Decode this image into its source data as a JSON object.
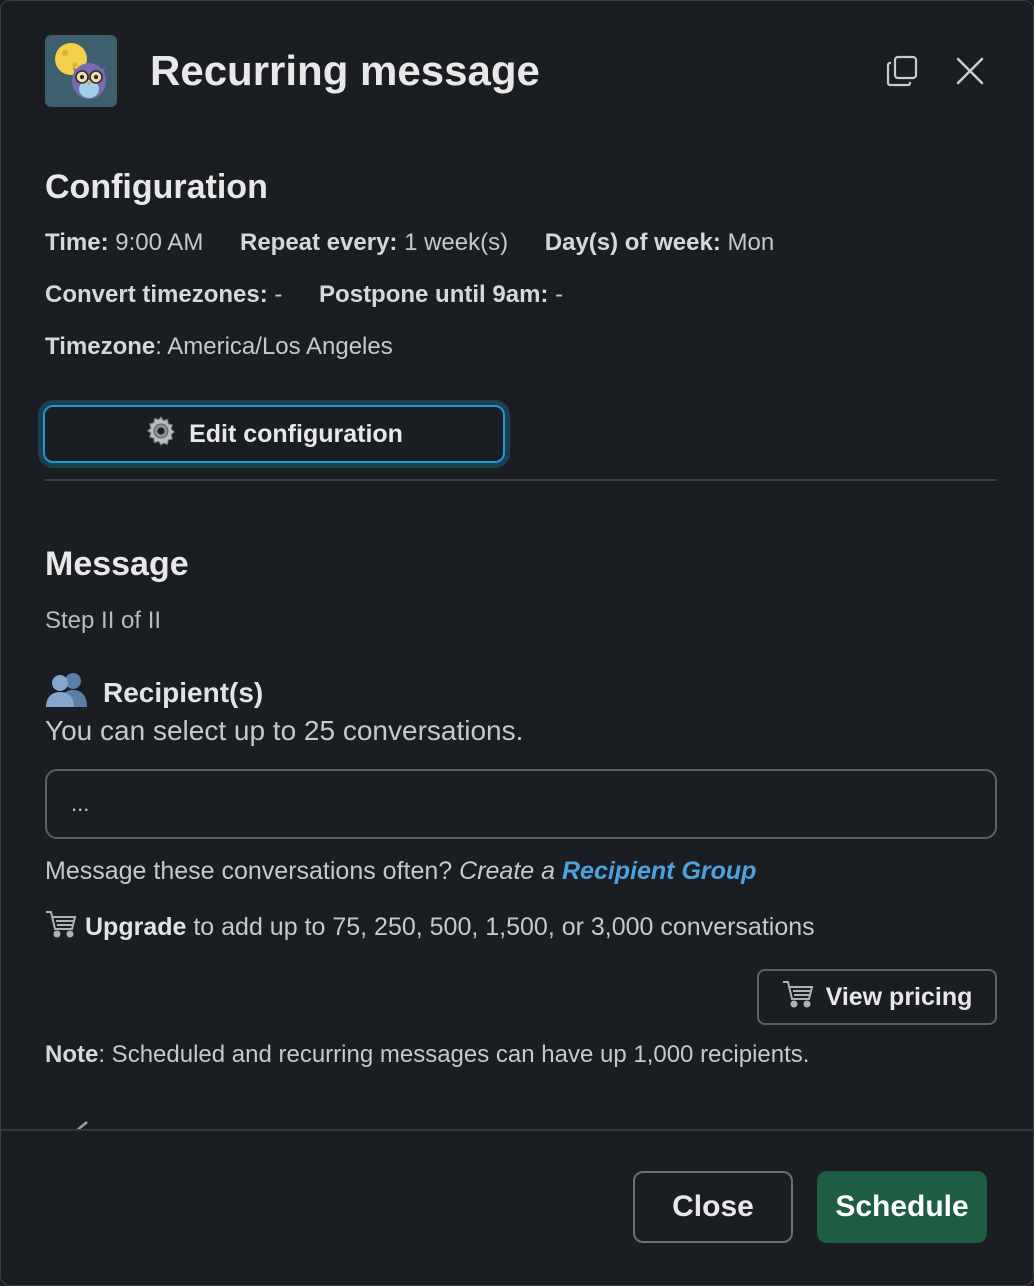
{
  "header": {
    "title": "Recurring message",
    "app_icon": "owl-moon-icon",
    "actions": [
      "copy-icon",
      "close-icon"
    ]
  },
  "configuration": {
    "heading": "Configuration",
    "time_label": "Time:",
    "time_value": "9:00 AM",
    "repeat_label": "Repeat every:",
    "repeat_value": "1 week(s)",
    "days_label": "Day(s) of week:",
    "days_value": "Mon",
    "convert_label": "Convert timezones:",
    "convert_value": "-",
    "postpone_label": "Postpone until 9am:",
    "postpone_value": "-",
    "timezone_label": "Timezone",
    "timezone_value": ": America/Los Angeles",
    "edit_button": "Edit configuration",
    "edit_icon": "gear-icon"
  },
  "message": {
    "heading": "Message",
    "step": "Step II of II",
    "recipients_label": "Recipient(s)",
    "recipients_icon": "busts-icon",
    "recipients_help": "You can select up to 25 conversations.",
    "recipients_value": "...",
    "group_hint_prefix": "Message these conversations often? ",
    "group_hint_italic": "Create a ",
    "group_hint_link": "Recipient Group",
    "upgrade_icon": "shopping-cart-icon",
    "upgrade_bold": "Upgrade",
    "upgrade_text": " to add up to 75, 250, 500, 1,500, or 3,000 conversations",
    "pricing_button": "View pricing",
    "note_label": "Note",
    "note_text": ": Scheduled and recurring messages can have up 1,000 recipients."
  },
  "footer": {
    "close_button": "Close",
    "schedule_button": "Schedule"
  },
  "colors": {
    "background": "#1a1d21",
    "accent_focus": "#1d9bd1",
    "link": "#4aa3df",
    "primary_button": "#1f5c44"
  }
}
